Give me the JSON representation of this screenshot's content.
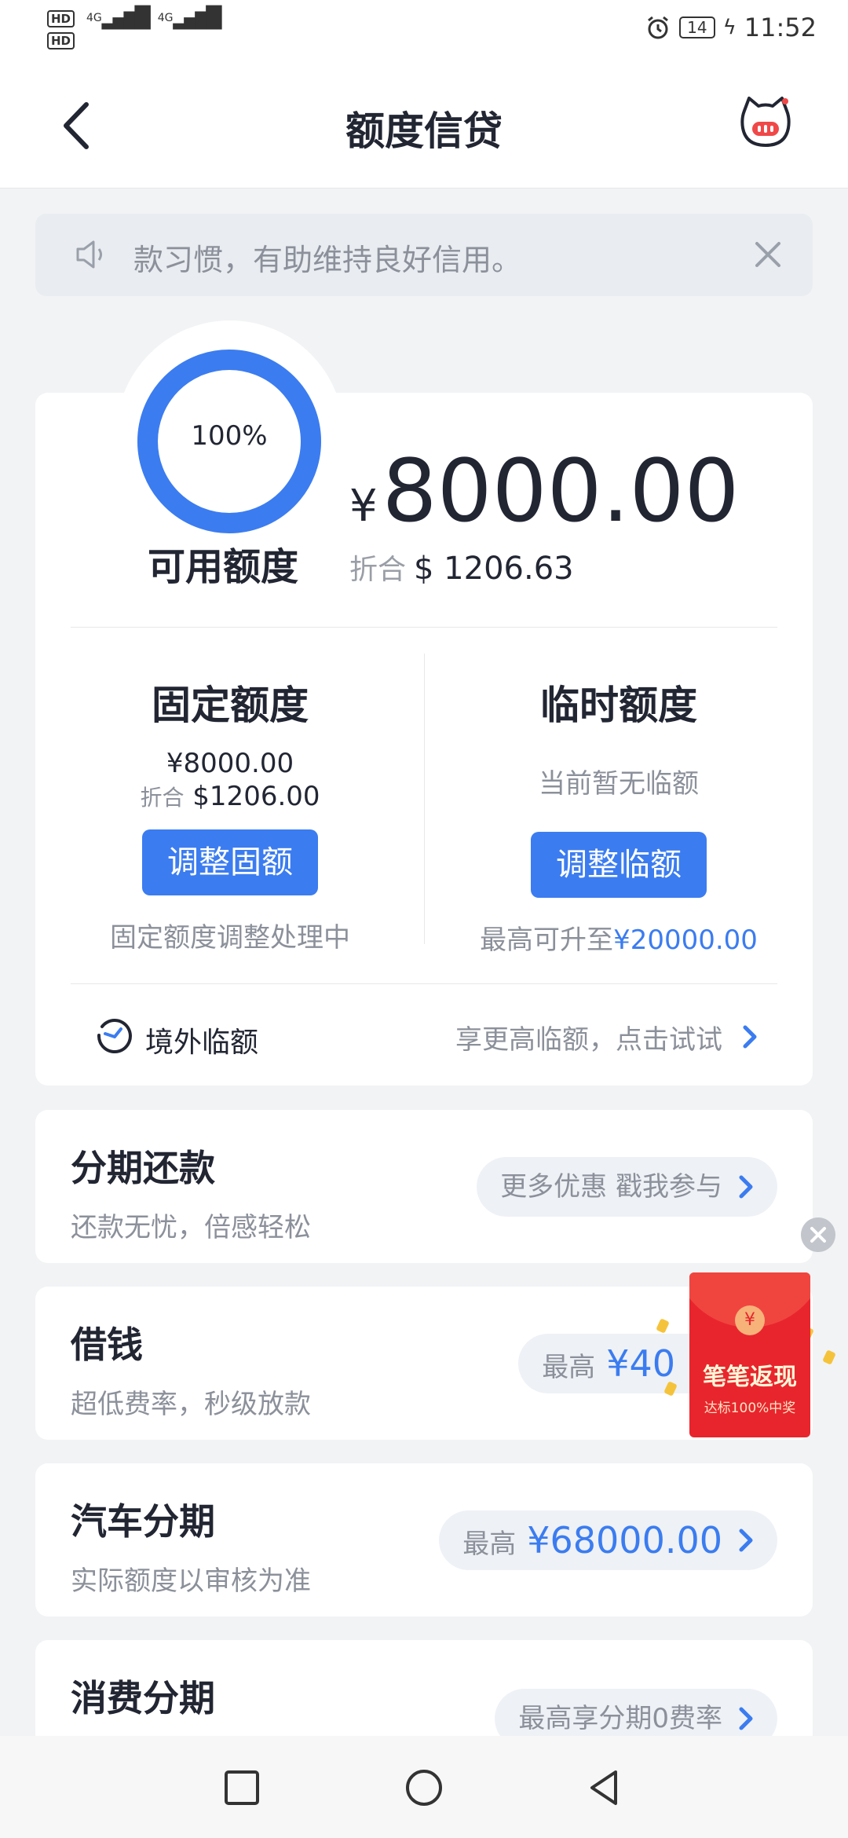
{
  "status_bar": {
    "hd1": "HD",
    "hd2": "HD",
    "net1": "4G",
    "net2": "4G",
    "battery": "14",
    "time": "11:52"
  },
  "header": {
    "title": "额度信贷"
  },
  "notice": {
    "text": "款习惯，有助维持良好信用。"
  },
  "credit": {
    "percent": "100%",
    "percent_value": 1.0,
    "available_label": "可用额度",
    "currency_symbol": "¥",
    "available_amount": "8000.00",
    "convert_label": "折合",
    "convert_value": "$ 1206.63"
  },
  "fixed": {
    "title": "固定额度",
    "amount": "¥8000.00",
    "convert_label": "折合",
    "convert_value": "$1206.00",
    "button": "调整固额",
    "status": "固定额度调整处理中"
  },
  "temporary": {
    "title": "临时额度",
    "status": "当前暂无临额",
    "button": "调整临额",
    "max_prefix": "最高可升至",
    "max_value": "¥20000.00"
  },
  "overseas": {
    "label": "境外临额",
    "hint": "享更高临额，点击试试"
  },
  "products": [
    {
      "title": "分期还款",
      "subtitle": "还款无忧，倍感轻松",
      "pill_prefix": "更多优惠 戳我参与",
      "pill_value": ""
    },
    {
      "title": "借钱",
      "subtitle": "超低费率，秒级放款",
      "pill_prefix": "最高",
      "pill_value": "¥40"
    },
    {
      "title": "汽车分期",
      "subtitle": "实际额度以审核为准",
      "pill_prefix": "最高",
      "pill_value": "¥68000.00"
    },
    {
      "title": "消费分期",
      "subtitle": "",
      "pill_prefix": "最高享分期0费率",
      "pill_value": ""
    }
  ],
  "promo": {
    "coin": "¥",
    "title": "笔笔返现",
    "subtitle": "达标100%中奖"
  },
  "colors": {
    "accent": "#3b7cf0",
    "promo_red": "#e8252d"
  }
}
